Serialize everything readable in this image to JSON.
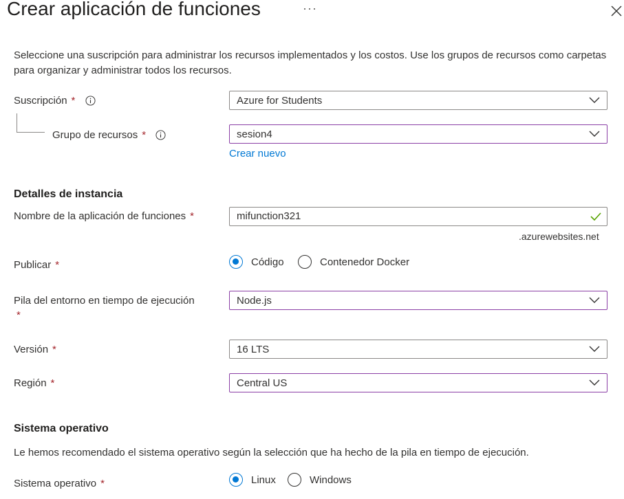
{
  "header": {
    "title": "Crear aplicación de funciones",
    "more_label": "···"
  },
  "intro_text": "Seleccione una suscripción para administrar los recursos implementados y los costos. Use los grupos de recursos como carpetas para organizar y administrar todos los recursos.",
  "subscription": {
    "label": "Suscripción",
    "required": "*",
    "value": "Azure for Students"
  },
  "resource_group": {
    "label": "Grupo de recursos",
    "required": "*",
    "value": "sesion4",
    "create_new": "Crear nuevo"
  },
  "instance": {
    "heading": "Detalles de instancia",
    "app_name": {
      "label": "Nombre de la aplicación de funciones",
      "required": "*",
      "value": "mifunction321",
      "suffix": ".azurewebsites.net"
    },
    "publish": {
      "label": "Publicar",
      "required": "*",
      "options": [
        "Código",
        "Contenedor Docker"
      ],
      "selected": "Código"
    },
    "runtime_stack": {
      "label": "Pila del entorno en tiempo de ejecución",
      "required": "*",
      "value": "Node.js"
    },
    "version": {
      "label": "Versión",
      "required": "*",
      "value": "16 LTS"
    },
    "region": {
      "label": "Región",
      "required": "*",
      "value": "Central US"
    }
  },
  "os": {
    "heading": "Sistema operativo",
    "description": "Le hemos recomendado el sistema operativo según la selección que ha hecho de la pila en tiempo de ejecución.",
    "label": "Sistema operativo",
    "required": "*",
    "options": [
      "Linux",
      "Windows"
    ],
    "selected": "Linux"
  },
  "colors": {
    "accent": "#0078d4",
    "focus_border": "#8a3ea5",
    "required": "#a4262c",
    "valid": "#57a300"
  },
  "icons": [
    "close-icon",
    "info-icon",
    "chevron-down-icon",
    "checkmark-icon"
  ]
}
